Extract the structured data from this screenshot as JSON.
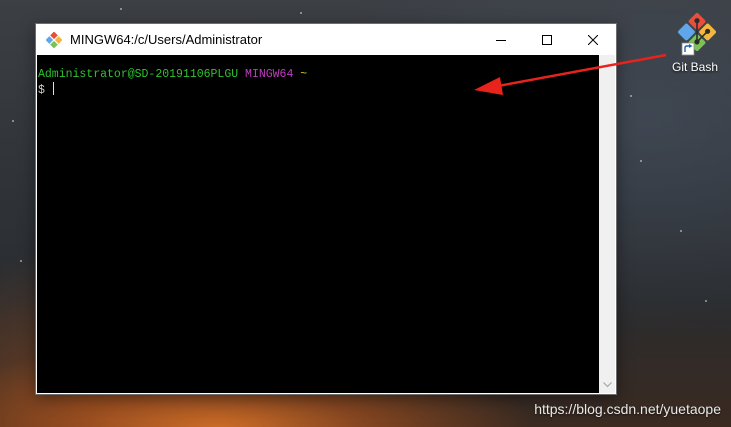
{
  "window": {
    "title": "MINGW64:/c/Users/Administrator"
  },
  "terminal": {
    "user_host": "Administrator@SD-20191106PLGU",
    "env": "MINGW64",
    "cwd": "~",
    "prompt": "$ "
  },
  "desktop": {
    "shortcut_label": "Git Bash"
  },
  "watermark": "https://blog.csdn.net/yuetaope",
  "colors": {
    "terminal_bg": "#000000",
    "prompt_user": "#2fc22f",
    "prompt_env": "#c13cc1",
    "prompt_cwd": "#c7c72c",
    "annotation_arrow": "#e8231c"
  },
  "icons": {
    "app": "git-diamond-icon",
    "minimize": "minimize-icon",
    "maximize": "maximize-icon",
    "close": "close-icon",
    "shortcut": "git-bash-shortcut-icon",
    "shortcut_overlay": "shortcut-arrow-icon"
  }
}
